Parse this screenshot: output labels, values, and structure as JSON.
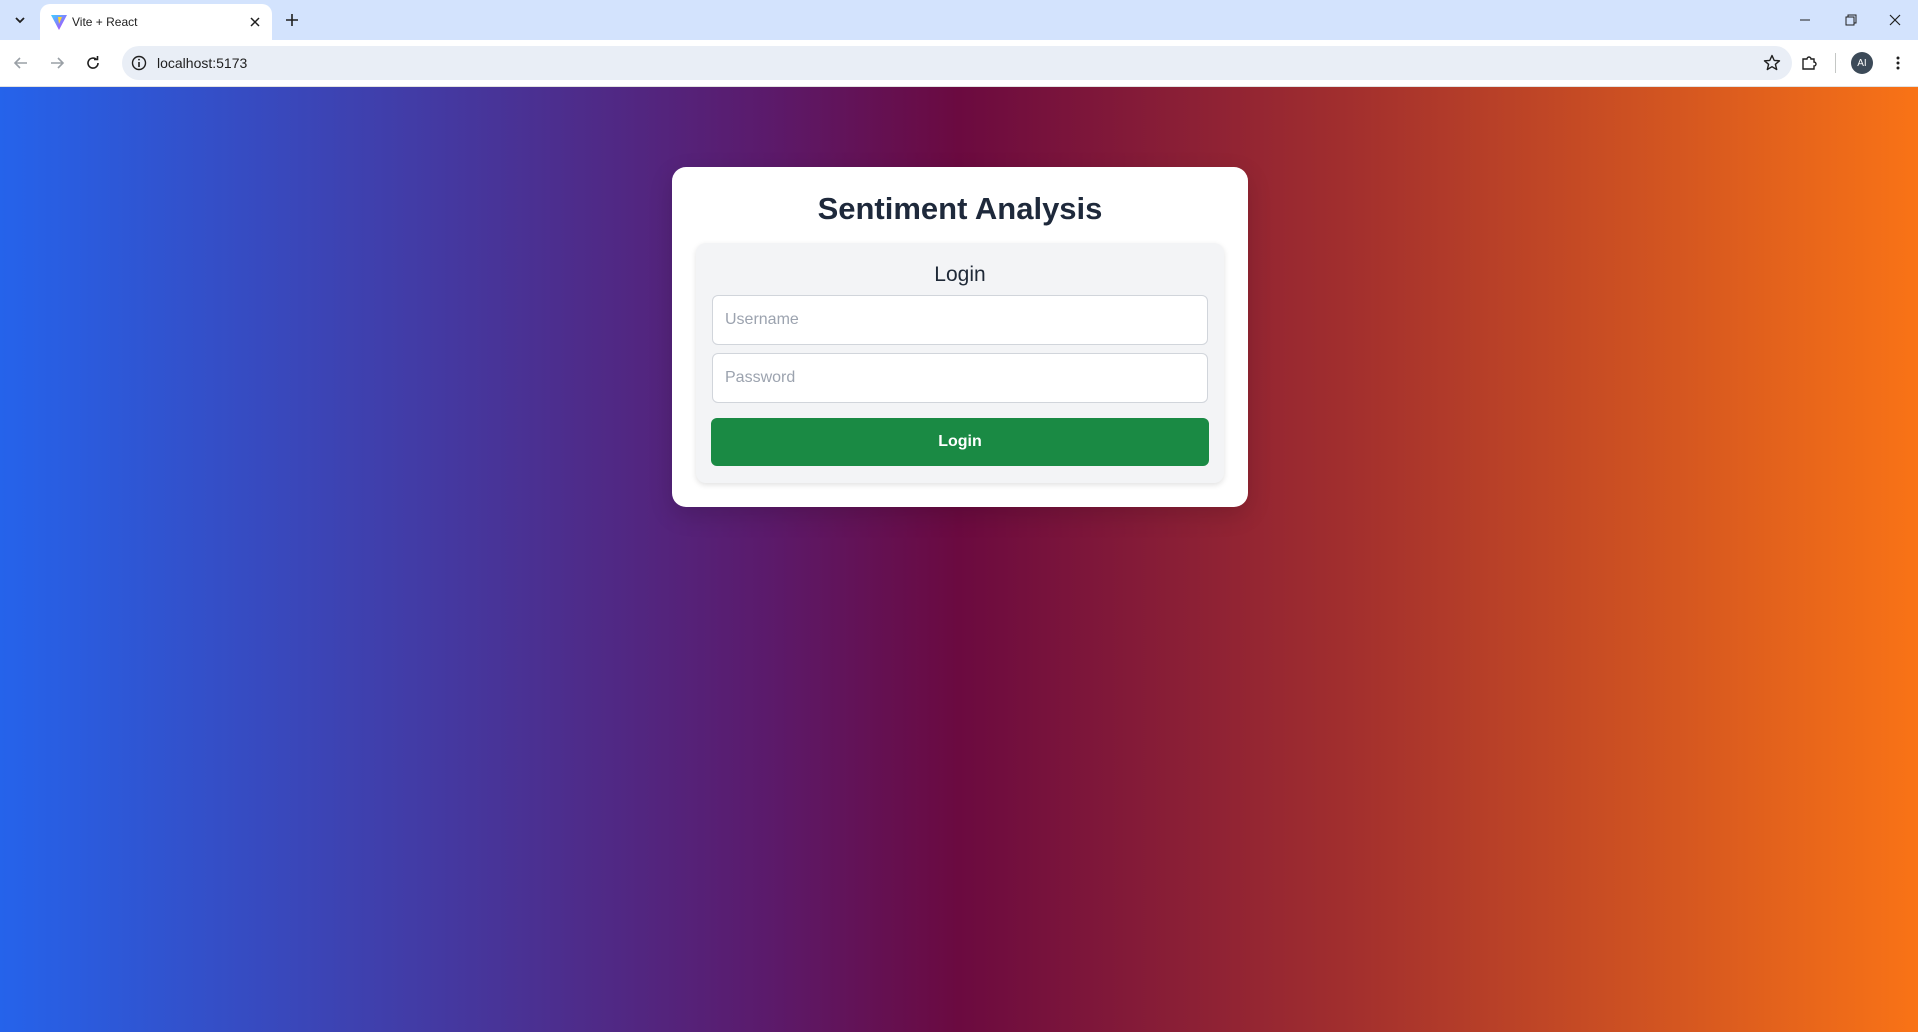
{
  "browser": {
    "tab": {
      "title": "Vite + React"
    },
    "address_bar": {
      "url": "localhost:5173"
    },
    "profile": {
      "initials": "AI"
    }
  },
  "app": {
    "title": "Sentiment Analysis",
    "login": {
      "heading": "Login",
      "username_placeholder": "Username",
      "password_placeholder": "Password",
      "submit_label": "Login"
    }
  },
  "colors": {
    "gradient_start": "#2563eb",
    "gradient_mid": "#6b0a40",
    "gradient_end": "#f97316",
    "login_button": "#1a8a44"
  },
  "icons": {
    "tab_search": "chevron-down-icon",
    "favicon": "vite-logo-icon",
    "tab_close": "close-icon",
    "new_tab": "plus-icon",
    "back": "arrow-left-icon",
    "forward": "arrow-right-icon",
    "reload": "reload-icon",
    "site_info": "info-icon",
    "bookmark": "star-icon",
    "extensions": "puzzle-icon",
    "menu": "more-vert-icon"
  }
}
